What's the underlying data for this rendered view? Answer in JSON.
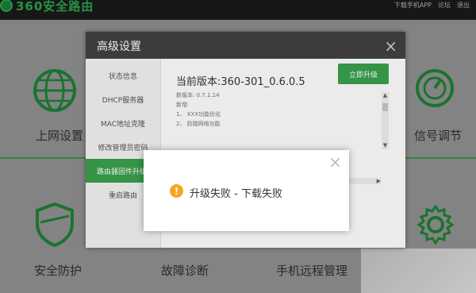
{
  "topbar": {
    "brand": "360安全路由",
    "links": [
      "下载手机APP",
      "论坛",
      "退出"
    ]
  },
  "dashboard": {
    "tiles": [
      {
        "label": "上网设置",
        "icon": "globe-icon"
      },
      {
        "label": "信号调节",
        "icon": "gauge-icon"
      },
      {
        "label": "安全防护",
        "icon": "shield-icon"
      },
      {
        "label": "故障诊断",
        "icon": "diagnose-icon"
      },
      {
        "label": "手机远程管理",
        "icon": "phone-icon"
      },
      {
        "label": "",
        "icon": "gear-icon"
      }
    ]
  },
  "advanced": {
    "title": "高级设置",
    "close_icon": "×",
    "menu": [
      {
        "label": "状态信息",
        "active": false
      },
      {
        "label": "DHCP服务器",
        "active": false
      },
      {
        "label": "MAC地址克隆",
        "active": false
      },
      {
        "label": "修改管理员密码",
        "active": false
      },
      {
        "label": "路由器固件升级",
        "active": true
      },
      {
        "label": "重启路由",
        "active": false
      }
    ],
    "current_version": "当前版本:360-301_0.6.0.5",
    "upgrade_button": "立即升级",
    "notes": [
      "新版本: 0.7.1.14",
      "新增:",
      "1、 XXX功能优化",
      "2、 防蹭网络功能"
    ]
  },
  "dialog": {
    "close_icon": "×",
    "warn_icon": "!",
    "message": "升级失败 - 下载失败"
  },
  "colors": {
    "accent_green": "#3aa14c",
    "warning_orange": "#f5a623",
    "header_dark": "#424242"
  }
}
